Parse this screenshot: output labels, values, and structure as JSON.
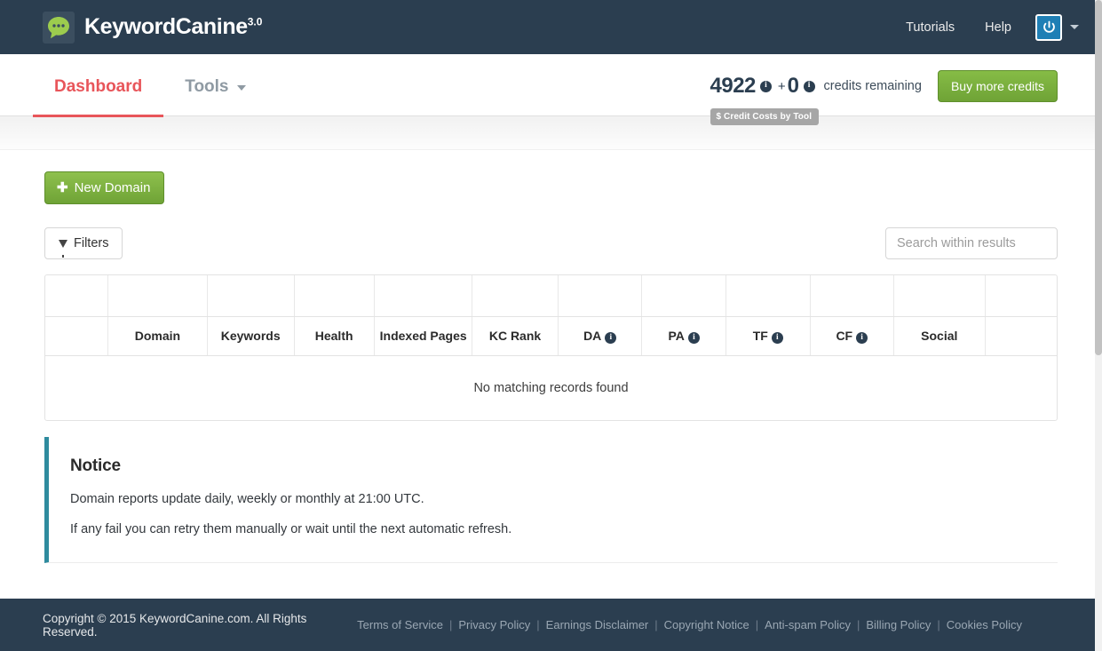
{
  "brand": {
    "name": "KeywordCanine",
    "version": "3.0",
    "logo_icon": "speech-bubble-dots-icon"
  },
  "topnav": {
    "links": [
      {
        "label": "Tutorials"
      },
      {
        "label": "Help"
      }
    ],
    "power_icon": "power-icon",
    "caret_icon": "chevron-down-icon"
  },
  "mainnav": {
    "items": [
      {
        "label": "Dashboard",
        "active": true,
        "has_caret": false
      },
      {
        "label": "Tools",
        "active": false,
        "has_caret": true
      }
    ]
  },
  "credits": {
    "amount": "4922",
    "plus": "+",
    "bonus": "0",
    "label": "credits remaining",
    "info_icon": "info-circle-icon",
    "buy_button": "Buy more credits",
    "costs_badge": "$ Credit Costs by Tool"
  },
  "actions": {
    "new_domain": "New Domain",
    "new_domain_icon": "plus-icon",
    "filters": "Filters",
    "filters_icon": "funnel-icon"
  },
  "search": {
    "placeholder": "Search within results",
    "value": ""
  },
  "table": {
    "columns": [
      {
        "label": "",
        "info": false
      },
      {
        "label": "Domain",
        "info": false
      },
      {
        "label": "Keywords",
        "info": false
      },
      {
        "label": "Health",
        "info": false
      },
      {
        "label": "Indexed Pages",
        "info": false
      },
      {
        "label": "KC Rank",
        "info": false
      },
      {
        "label": "DA",
        "info": true
      },
      {
        "label": "PA",
        "info": true
      },
      {
        "label": "TF",
        "info": true
      },
      {
        "label": "CF",
        "info": true
      },
      {
        "label": "Social",
        "info": false
      },
      {
        "label": "",
        "info": false
      }
    ],
    "empty_message": "No matching records found",
    "rows": []
  },
  "notice": {
    "title": "Notice",
    "line1": "Domain reports update daily, weekly or monthly at 21:00 UTC.",
    "line2": "If any fail you can retry them manually or wait until the next automatic refresh."
  },
  "footer": {
    "copyright": "Copyright © 2015 KeywordCanine.com. All Rights Reserved.",
    "links": [
      {
        "label": "Terms of Service"
      },
      {
        "label": "Privacy Policy"
      },
      {
        "label": "Earnings Disclaimer"
      },
      {
        "label": "Copyright Notice"
      },
      {
        "label": "Anti-spam Policy"
      },
      {
        "label": "Billing Policy"
      },
      {
        "label": "Cookies Policy"
      }
    ],
    "separator": "|"
  },
  "colors": {
    "header_bg": "#2b3e50",
    "accent_red": "#e8555a",
    "green_button": "#7bb040",
    "notice_border": "#2e8b9e",
    "power_blue": "#1f7fb5"
  }
}
